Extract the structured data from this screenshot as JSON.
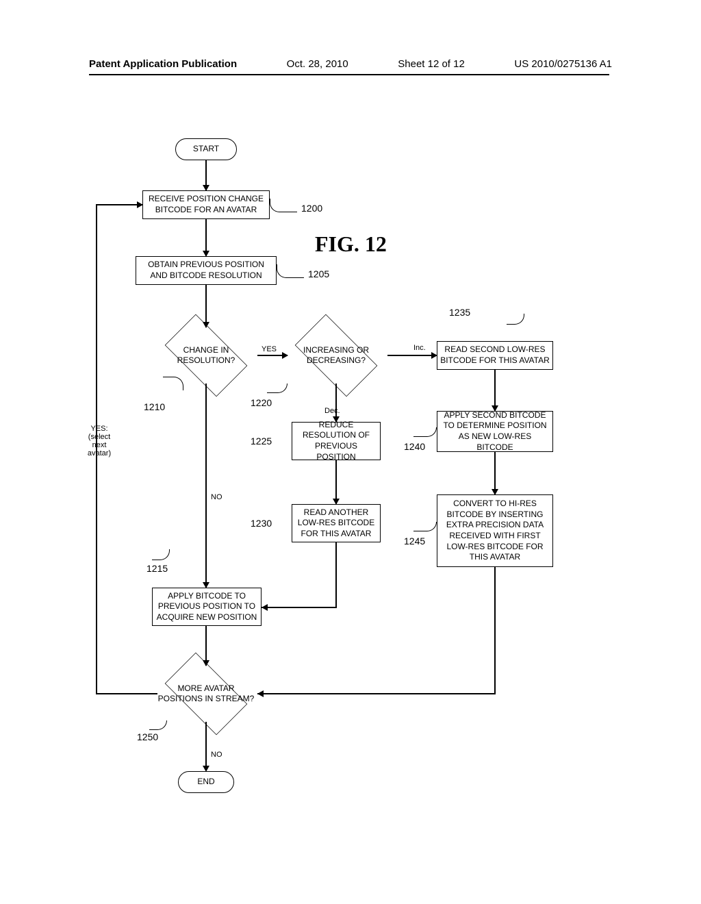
{
  "header": {
    "pub_type": "Patent Application Publication",
    "date": "Oct. 28, 2010",
    "sheet": "Sheet 12 of 12",
    "pub_number": "US 2010/0275136 A1"
  },
  "figure_title": "FIG. 12",
  "nodes": {
    "start": "START",
    "n1200": "RECEIVE POSITION CHANGE BITCODE FOR AN AVATAR",
    "n1205": "OBTAIN PREVIOUS POSITION AND BITCODE RESOLUTION",
    "n1210": "CHANGE IN RESOLUTION?",
    "n1220": "INCREASING OR DECREASING?",
    "n1225": "REDUCE RESOLUTION OF PREVIOUS POSITION",
    "n1230": "READ ANOTHER LOW-RES BITCODE FOR THIS AVATAR",
    "n1235": "READ SECOND LOW-RES BITCODE FOR THIS AVATAR",
    "n1240": "APPLY SECOND BITCODE TO DETERMINE POSITION AS NEW LOW-RES BITCODE",
    "n1245": "CONVERT TO HI-RES BITCODE BY INSERTING EXTRA PRECISION DATA RECEIVED WITH FIRST LOW-RES BITCODE FOR THIS AVATAR",
    "n1215": "APPLY BITCODE TO PREVIOUS POSITION TO ACQUIRE NEW POSITION",
    "n1250": "MORE AVATAR POSITIONS IN STREAM?",
    "end": "END"
  },
  "refs": {
    "r1200": "1200",
    "r1205": "1205",
    "r1210": "1210",
    "r1215": "1215",
    "r1220": "1220",
    "r1225": "1225",
    "r1230": "1230",
    "r1235": "1235",
    "r1240": "1240",
    "r1245": "1245",
    "r1250": "1250"
  },
  "edge_labels": {
    "d1210_yes": "YES",
    "d1210_no": "NO",
    "d1220_inc": "Inc.",
    "d1220_dec": "Dec.",
    "d1250_yes": "YES:\n(select\nnext\navatar)",
    "d1250_no": "NO"
  }
}
